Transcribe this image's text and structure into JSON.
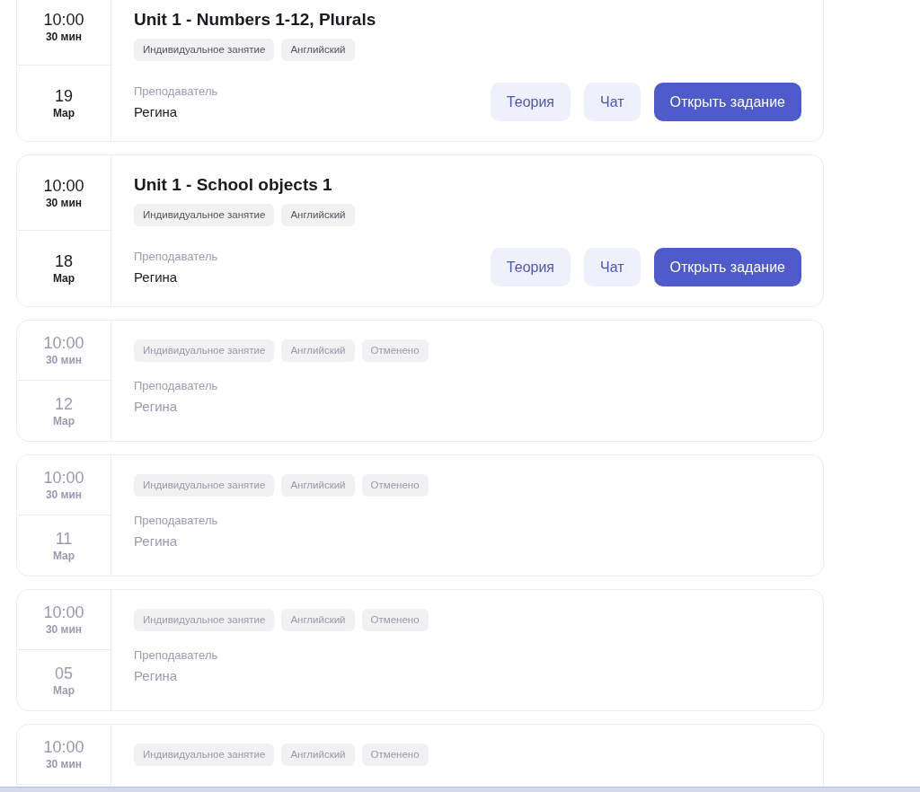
{
  "lessons": [
    {
      "time": "10:00",
      "duration": "30 мин",
      "day": "19",
      "month": "Мар",
      "title": "Unit 1 - Numbers 1-12, Plurals",
      "tags": [
        "Индивидуальное занятие",
        "Английский"
      ],
      "cancelled": false,
      "teacher_label": "Преподаватель",
      "teacher": "Регина",
      "buttons": [
        {
          "label": "Теория",
          "kind": "secondary"
        },
        {
          "label": "Чат",
          "kind": "secondary"
        },
        {
          "label": "Открыть задание",
          "kind": "primary"
        }
      ]
    },
    {
      "time": "10:00",
      "duration": "30 мин",
      "day": "18",
      "month": "Мар",
      "title": "Unit 1 - School objects 1",
      "tags": [
        "Индивидуальное занятие",
        "Английский"
      ],
      "cancelled": false,
      "teacher_label": "Преподаватель",
      "teacher": "Регина",
      "buttons": [
        {
          "label": "Теория",
          "kind": "secondary"
        },
        {
          "label": "Чат",
          "kind": "secondary"
        },
        {
          "label": "Открыть задание",
          "kind": "primary"
        }
      ]
    },
    {
      "time": "10:00",
      "duration": "30 мин",
      "day": "12",
      "month": "Мар",
      "tags": [
        "Индивидуальное занятие",
        "Английский",
        "Отменено"
      ],
      "cancelled": true,
      "teacher_label": "Преподаватель",
      "teacher": "Регина"
    },
    {
      "time": "10:00",
      "duration": "30 мин",
      "day": "11",
      "month": "Мар",
      "tags": [
        "Индивидуальное занятие",
        "Английский",
        "Отменено"
      ],
      "cancelled": true,
      "teacher_label": "Преподаватель",
      "teacher": "Регина"
    },
    {
      "time": "10:00",
      "duration": "30 мин",
      "day": "05",
      "month": "Мар",
      "tags": [
        "Индивидуальное занятие",
        "Английский",
        "Отменено"
      ],
      "cancelled": true,
      "teacher_label": "Преподаватель",
      "teacher": "Регина"
    },
    {
      "time": "10:00",
      "duration": "30 мин",
      "tags": [
        "Индивидуальное занятие",
        "Английский",
        "Отменено"
      ],
      "cancelled": true
    }
  ]
}
